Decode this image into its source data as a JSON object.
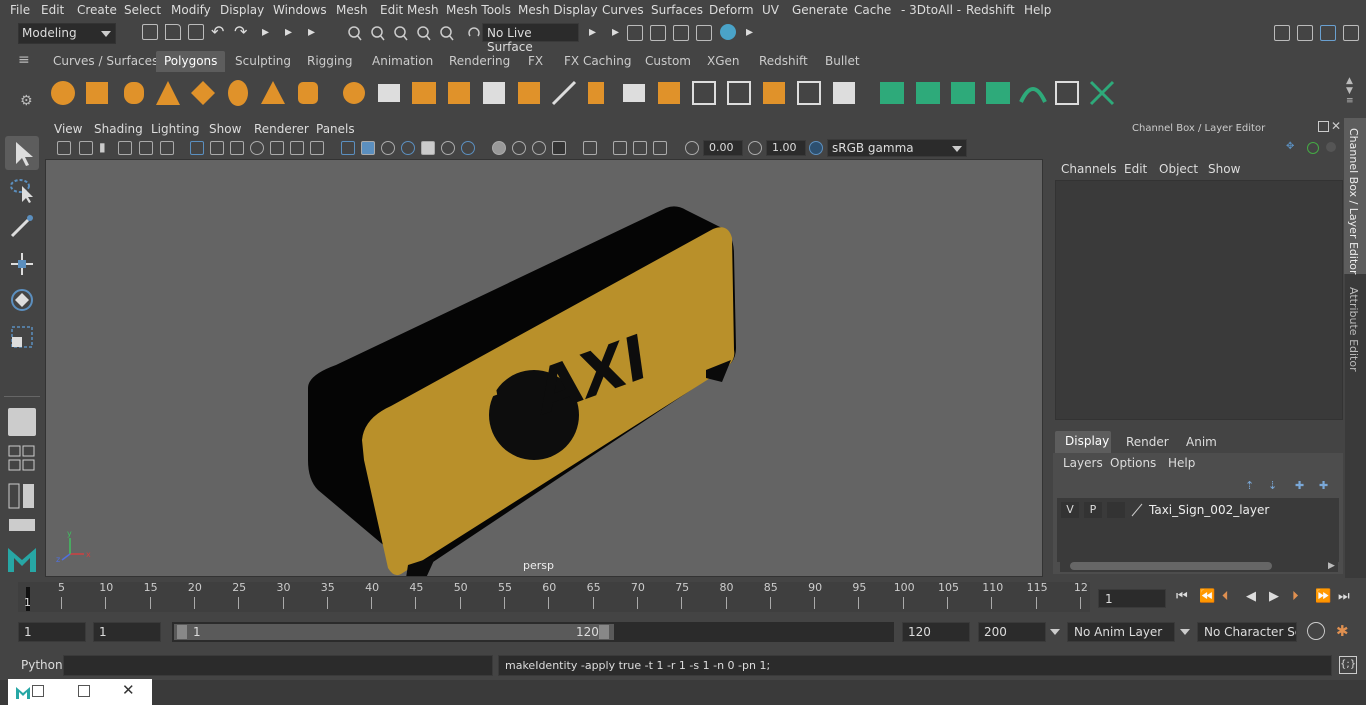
{
  "menu": [
    "File",
    "Edit",
    "Create",
    "Select",
    "Modify",
    "Display",
    "Windows",
    "Mesh",
    "Edit Mesh",
    "Mesh Tools",
    "Mesh Display",
    "Curves",
    "Surfaces",
    "Deform",
    "UV",
    "Generate",
    "Cache",
    "- 3DtoAll -",
    "Redshift",
    "Help"
  ],
  "mode": "Modeling",
  "live_surface": "No Live Surface",
  "shelf_tabs": [
    "Curves / Surfaces",
    "Polygons",
    "Sculpting",
    "Rigging",
    "Animation",
    "Rendering",
    "FX",
    "FX Caching",
    "Custom",
    "XGen",
    "Redshift",
    "Bullet"
  ],
  "shelf_active": "Polygons",
  "viewport": {
    "menu": [
      "View",
      "Shading",
      "Lighting",
      "Show",
      "Renderer",
      "Panels"
    ],
    "exposure": "0.00",
    "gamma": "1.00",
    "color_space": "sRGB gamma",
    "camera_label": "persp",
    "sign_text": "TAXI"
  },
  "channel_box": {
    "title": "Channel Box / Layer Editor",
    "menu": [
      "Channels",
      "Edit",
      "Object",
      "Show"
    ]
  },
  "layer_editor": {
    "tabs": [
      "Display",
      "Render",
      "Anim"
    ],
    "active_tab": "Display",
    "menu": [
      "Layers",
      "Options",
      "Help"
    ],
    "layer": {
      "v": "V",
      "p": "P",
      "name": "Taxi_Sign_002_layer"
    }
  },
  "side_tabs": [
    "Channel Box / Layer Editor",
    "Attribute Editor"
  ],
  "timeline": {
    "ticks": [
      "5",
      "10",
      "15",
      "20",
      "25",
      "30",
      "35",
      "40",
      "45",
      "50",
      "55",
      "60",
      "65",
      "70",
      "75",
      "80",
      "85",
      "90",
      "95",
      "100",
      "105",
      "110",
      "115",
      "12"
    ],
    "start_marker": "1",
    "current_frame": "1"
  },
  "range": {
    "start": "1",
    "start2": "1",
    "slider_start": "1",
    "slider_end": "120",
    "end": "120",
    "end2": "200",
    "anim_layer": "No Anim Layer",
    "char_set": "No Character Set"
  },
  "command": {
    "lang": "Python",
    "output": "makeIdentity -apply true -t 1 -r 1 -s 1 -n 0 -pn 1;"
  },
  "colors": {
    "sign_yellow": "#b9902a",
    "sign_black": "#0a0a0a",
    "viewport_bg": "#646464",
    "maya_teal": "#27a7a5",
    "accent_blue": "#5b8fbf"
  }
}
